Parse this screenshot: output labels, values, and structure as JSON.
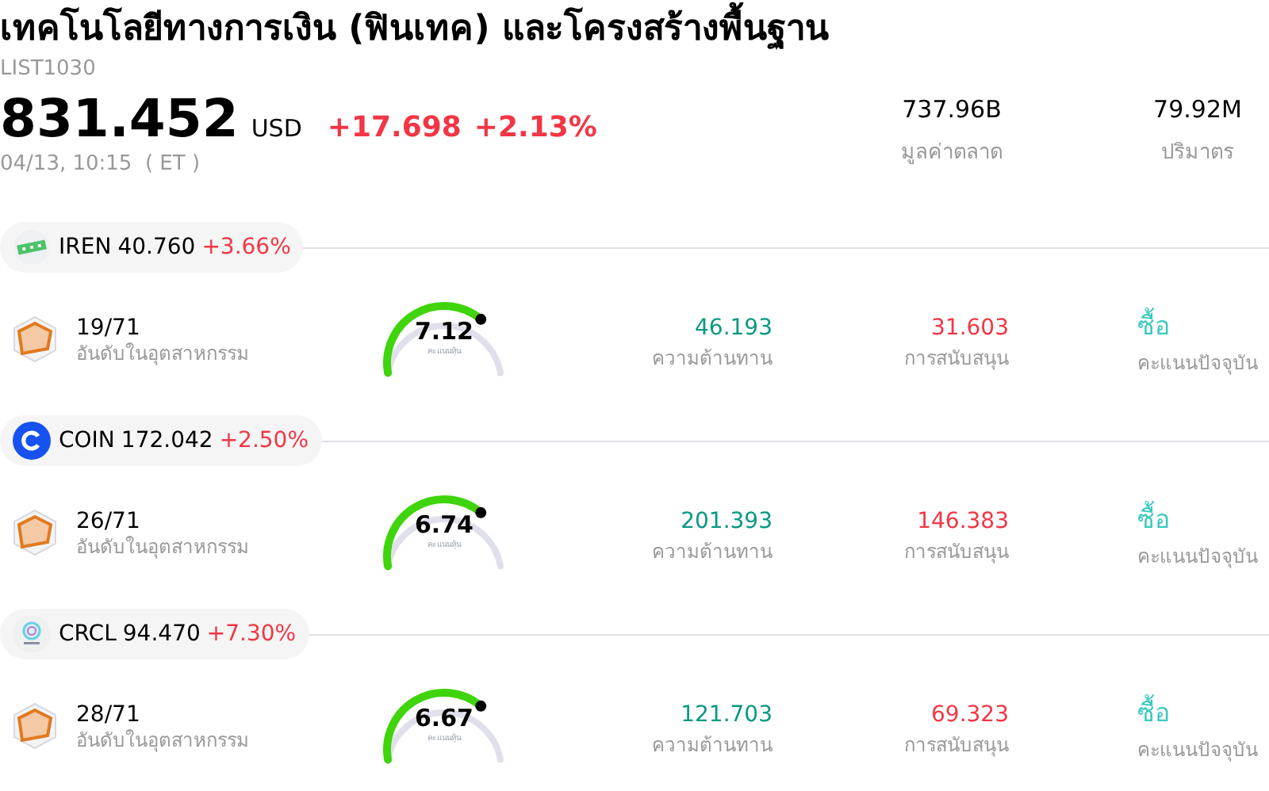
{
  "header": {
    "title": "เทคโนโลยีทางการเงิน (ฟินเทค) และโครงสร้างพื้นฐาน",
    "code": "LIST1030",
    "price": "831.452",
    "currency": "USD",
    "change": "+17.698",
    "change_pct": "+2.13%",
    "time": "04/13, 10:15  ( ET )",
    "stats": [
      {
        "value": "737.96B",
        "label": "มูลค่าตลาด"
      },
      {
        "value": "79.92M",
        "label": "ปริมาตร"
      }
    ]
  },
  "stocks": [
    {
      "kind": "bars",
      "ticker": "IREN",
      "price": "40.760",
      "change": "+3.66%",
      "rank": "19/71",
      "rank_label": "อันดับในอุตสาหกรรม",
      "score": "7.12",
      "score_label": "คะแนนหุ้น",
      "resistance": "46.193",
      "resistance_label": "ความต้านทาน",
      "support": "31.603",
      "support_label": "การสนับสนุน",
      "rating": "ซื้อ",
      "rating_label": "คะแนนปัจจุบัน"
    },
    {
      "kind": "coin",
      "ticker": "COIN",
      "price": "172.042",
      "change": "+2.50%",
      "rank": "26/71",
      "rank_label": "อันดับในอุตสาหกรรม",
      "score": "6.74",
      "score_label": "คะแนนหุ้น",
      "resistance": "201.393",
      "resistance_label": "ความต้านทาน",
      "support": "146.383",
      "support_label": "การสนับสนุน",
      "rating": "ซื้อ",
      "rating_label": "คะแนนปัจจุบัน"
    },
    {
      "kind": "ring",
      "ticker": "CRCL",
      "price": "94.470",
      "change": "+7.30%",
      "rank": "28/71",
      "rank_label": "อันดับในอุตสาหกรรม",
      "score": "6.67",
      "score_label": "คะแนนหุ้น",
      "resistance": "121.703",
      "resistance_label": "ความต้านทาน",
      "support": "69.323",
      "support_label": "การสนับสนุน",
      "rating": "ซื้อ",
      "rating_label": "คะแนนปัจจุบัน"
    }
  ]
}
